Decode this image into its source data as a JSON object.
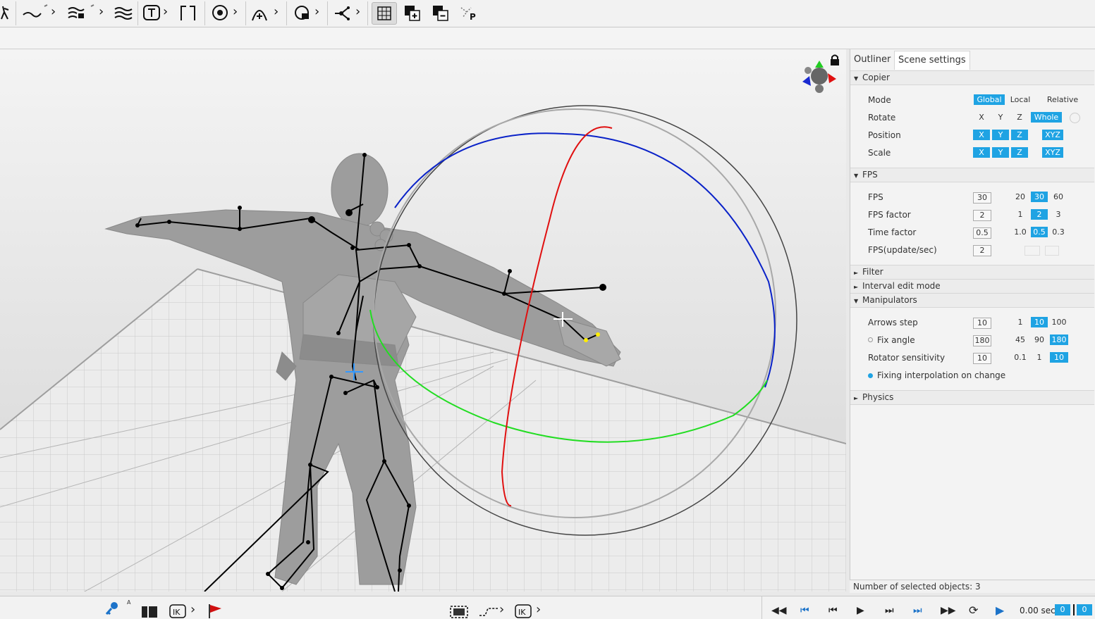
{
  "toolbar": {
    "icons": [
      "pose-icon",
      "curve-icon",
      "curve-lock-icon",
      "wave-icon",
      "text-tool-icon",
      "bracket-icon",
      "camera-lock-icon",
      "arc-add-icon",
      "target-lock-icon",
      "branch-icon",
      "grid-icon",
      "add-layer-icon",
      "remove-layer-icon",
      "skeleton-p-icon"
    ]
  },
  "panel": {
    "tabs": [
      "Outliner",
      "Scene settings"
    ],
    "copier": {
      "title": "Copier",
      "mode_label": "Mode",
      "mode_options": [
        "Global",
        "Local",
        "Relative"
      ],
      "rotate_label": "Rotate",
      "rotate_options": [
        "X",
        "Y",
        "Z",
        "Whole"
      ],
      "position_label": "Position",
      "position_options": [
        "X",
        "Y",
        "Z",
        "XYZ"
      ],
      "scale_label": "Scale",
      "scale_options": [
        "X",
        "Y",
        "Z",
        "XYZ"
      ]
    },
    "fps": {
      "title": "FPS",
      "fps_label": "FPS",
      "fps_value": "30",
      "fps_presets": [
        "20",
        "30",
        "60"
      ],
      "factor_label": "FPS factor",
      "factor_value": "2",
      "factor_presets": [
        "1",
        "2",
        "3"
      ],
      "time_label": "Time factor",
      "time_value": "0.5",
      "time_presets": [
        "1.0",
        "0.5",
        "0.3"
      ],
      "update_label": "FPS(update/sec)",
      "update_value": "2"
    },
    "filter_title": "Filter",
    "interval_title": "Interval edit mode",
    "manipulators": {
      "title": "Manipulators",
      "arrows_label": "Arrows step",
      "arrows_value": "10",
      "arrows_presets": [
        "1",
        "10",
        "100"
      ],
      "fix_label": "Fix angle",
      "fix_value": "180",
      "fix_presets": [
        "45",
        "90",
        "180"
      ],
      "rot_label": "Rotator sensitivity",
      "rot_value": "10",
      "rot_presets": [
        "0.1",
        "1",
        "10"
      ],
      "interp_label": "Fixing interpolation on change"
    },
    "physics_title": "Physics",
    "status": "Number of selected objects: 3"
  },
  "bottom": {
    "time": "0.00 sec",
    "frame_a": "0",
    "frame_b": "0",
    "left_small": "A"
  },
  "colors": {
    "accent": "#1fa3e3",
    "axis_x": "#e01010",
    "axis_y": "#22dd22",
    "axis_z": "#0a22c8"
  }
}
